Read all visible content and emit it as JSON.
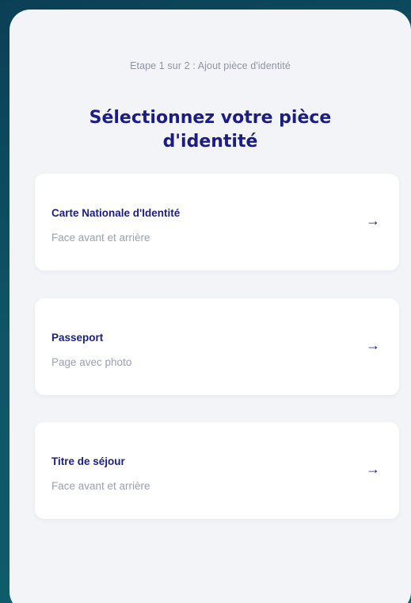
{
  "header": {
    "step_text": "Etape 1 sur 2 : Ajout pièce d'identité",
    "title": "Sélectionnez votre pièce d'identité"
  },
  "options": [
    {
      "label": "Carte Nationale d'Identité",
      "description": "Face avant et arrière",
      "icon": "arrow-right-icon"
    },
    {
      "label": "Passeport",
      "description": "Page avec photo",
      "icon": "arrow-right-icon"
    },
    {
      "label": "Titre de séjour",
      "description": "Face avant et arrière",
      "icon": "arrow-right-icon"
    }
  ],
  "colors": {
    "accent": "#1c1d84",
    "muted_text": "#9b9fae",
    "card_background": "#f3f4f8",
    "page_background": "#0e5566"
  }
}
